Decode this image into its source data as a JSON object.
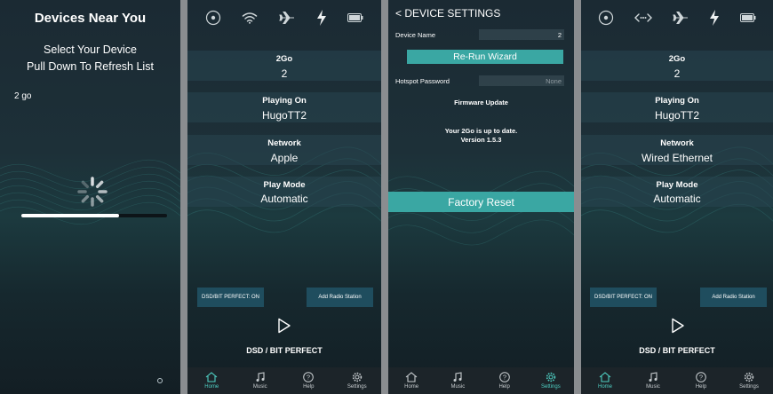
{
  "screen1": {
    "title": "Devices Near You",
    "subtitle_line1": "Select Your Device",
    "subtitle_line2": "Pull Down To Refresh List",
    "device_item": "2 go",
    "refresh_progress": 0.67
  },
  "screen2": {
    "rows": [
      {
        "label": "2Go",
        "value": "2"
      },
      {
        "label": "Playing On",
        "value": "HugoTT2"
      },
      {
        "label": "Network",
        "value": "Apple"
      },
      {
        "label": "Play Mode",
        "value": "Automatic"
      }
    ],
    "dsd_button": "DSD/BIT PERFECT: ON",
    "radio_button": "Add Radio Station",
    "mode_text": "DSD / BIT PERFECT"
  },
  "screen3": {
    "header": "< DEVICE SETTINGS",
    "device_name_label": "Device Name",
    "device_name_value": "2",
    "rerun_button": "Re-Run Wizard",
    "hotspot_label": "Hotspot Password",
    "hotspot_value": "None",
    "firmware_title": "Firmware Update",
    "firmware_line1": "Your 2Go is up to date.",
    "firmware_line2": "Version 1.5.3",
    "factory_button": "Factory Reset"
  },
  "screen4": {
    "rows": [
      {
        "label": "2Go",
        "value": "2"
      },
      {
        "label": "Playing On",
        "value": "HugoTT2"
      },
      {
        "label": "Network",
        "value": "Wired Ethernet"
      },
      {
        "label": "Play Mode",
        "value": "Automatic"
      }
    ],
    "dsd_button": "DSD/BIT PERFECT: ON",
    "radio_button": "Add Radio Station",
    "mode_text": "DSD / BIT PERFECT"
  },
  "tabs": [
    {
      "label": "Home",
      "icon": "home-icon"
    },
    {
      "label": "Music",
      "icon": "music-note-icon"
    },
    {
      "label": "Help",
      "icon": "help-icon"
    },
    {
      "label": "Settings",
      "icon": "gear-icon"
    }
  ],
  "colors": {
    "accent": "#3aa7a3",
    "active_tab": "#4fd0c4",
    "dark_button": "#1f4d5e",
    "background": "#1b2a33"
  }
}
